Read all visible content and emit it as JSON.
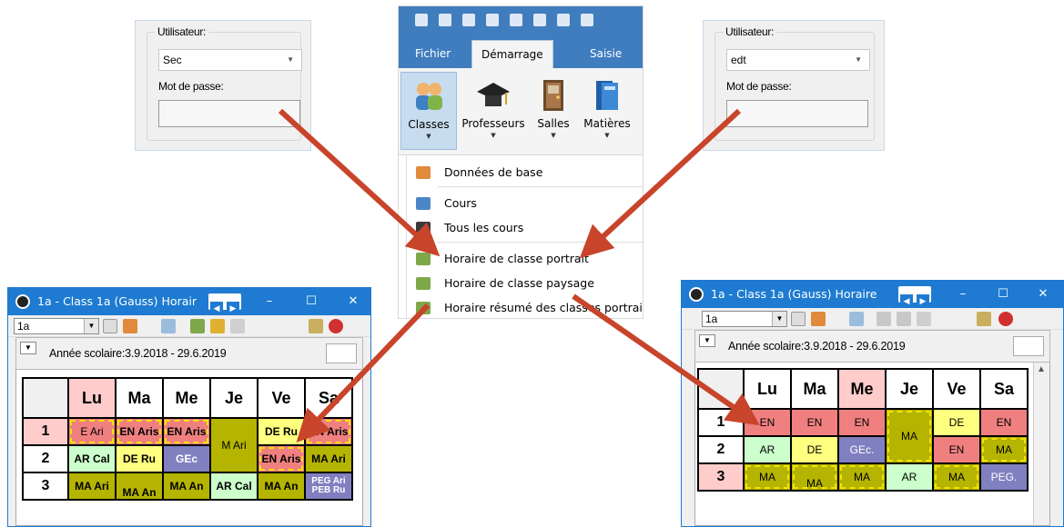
{
  "login_left": {
    "user_label": "Utilisateur:",
    "user_value": "Sec",
    "password_label": "Mot de passe:"
  },
  "login_right": {
    "user_label": "Utilisateur:",
    "user_value": "edt",
    "password_label": "Mot de passe:"
  },
  "ribbon": {
    "tabs": [
      "Fichier",
      "Démarrage",
      "Saisie de"
    ],
    "tools": [
      {
        "label": "Classes",
        "icon": "classes-icon"
      },
      {
        "label": "Professeurs",
        "icon": "teacher-cap-icon"
      },
      {
        "label": "Salles",
        "icon": "door-icon"
      },
      {
        "label": "Matières",
        "icon": "books-icon"
      }
    ],
    "menu": [
      {
        "label": "Données de base",
        "icon": "people-icon"
      },
      {
        "label": "Cours",
        "icon": "lessons-icon"
      },
      {
        "label": "Tous les cours",
        "icon": "monitor-icon"
      },
      {
        "label": "Horaire de classe portrait",
        "icon": "timetable-icon"
      },
      {
        "label": "Horaire de classe paysage",
        "icon": "timetable-icon"
      },
      {
        "label": "Horaire résumé des classes portrait",
        "icon": "timetable-icon"
      }
    ]
  },
  "win_left": {
    "title": "1a - Class 1a (Gauss)  Horair",
    "combo": "1a",
    "year": "Année scolaire:3.9.2018 - 29.6.2019",
    "days": [
      "Lu",
      "Ma",
      "Me",
      "Je",
      "Ve",
      "Sa"
    ],
    "periods": [
      "1",
      "2",
      "3"
    ],
    "cells": {
      "r1": [
        "E Ari",
        "EN Aris",
        "EN Aris",
        "M Ari",
        "DE Ru",
        "EN Aris"
      ],
      "r2": [
        "AR Cal",
        "DE Ru",
        "GEc",
        "EN Aris",
        "MA Ari"
      ],
      "r3": [
        "MA Ari",
        "MA An",
        "MA An",
        "AR Cal",
        "MA An",
        "PEG Ari",
        "PEB Ru"
      ]
    }
  },
  "win_right": {
    "title": "1a - Class 1a (Gauss)  Horaire",
    "combo": "1a",
    "year": "Année scolaire:3.9.2018 - 29.6.2019",
    "days": [
      "Lu",
      "Ma",
      "Me",
      "Je",
      "Ve",
      "Sa"
    ],
    "periods": [
      "1",
      "2",
      "3"
    ],
    "cells": {
      "r1": [
        "EN",
        "EN",
        "EN",
        "MA",
        "DE",
        "EN"
      ],
      "r2": [
        "AR",
        "DE",
        "GEc.",
        "EN",
        "MA"
      ],
      "r3": [
        "MA",
        "MA",
        "MA",
        "AR",
        "MA",
        "PEG."
      ]
    }
  },
  "colors": {
    "ribbon_blue": "#3f7dbf",
    "window_blue": "#1e7bd1",
    "arrow": "#c8442a",
    "olive": "#b5b400",
    "pink": "#f08080",
    "yellow": "#ffff80",
    "green": "#ccffcc",
    "purple": "#8080c0",
    "day_pink": "#ffcccc"
  }
}
